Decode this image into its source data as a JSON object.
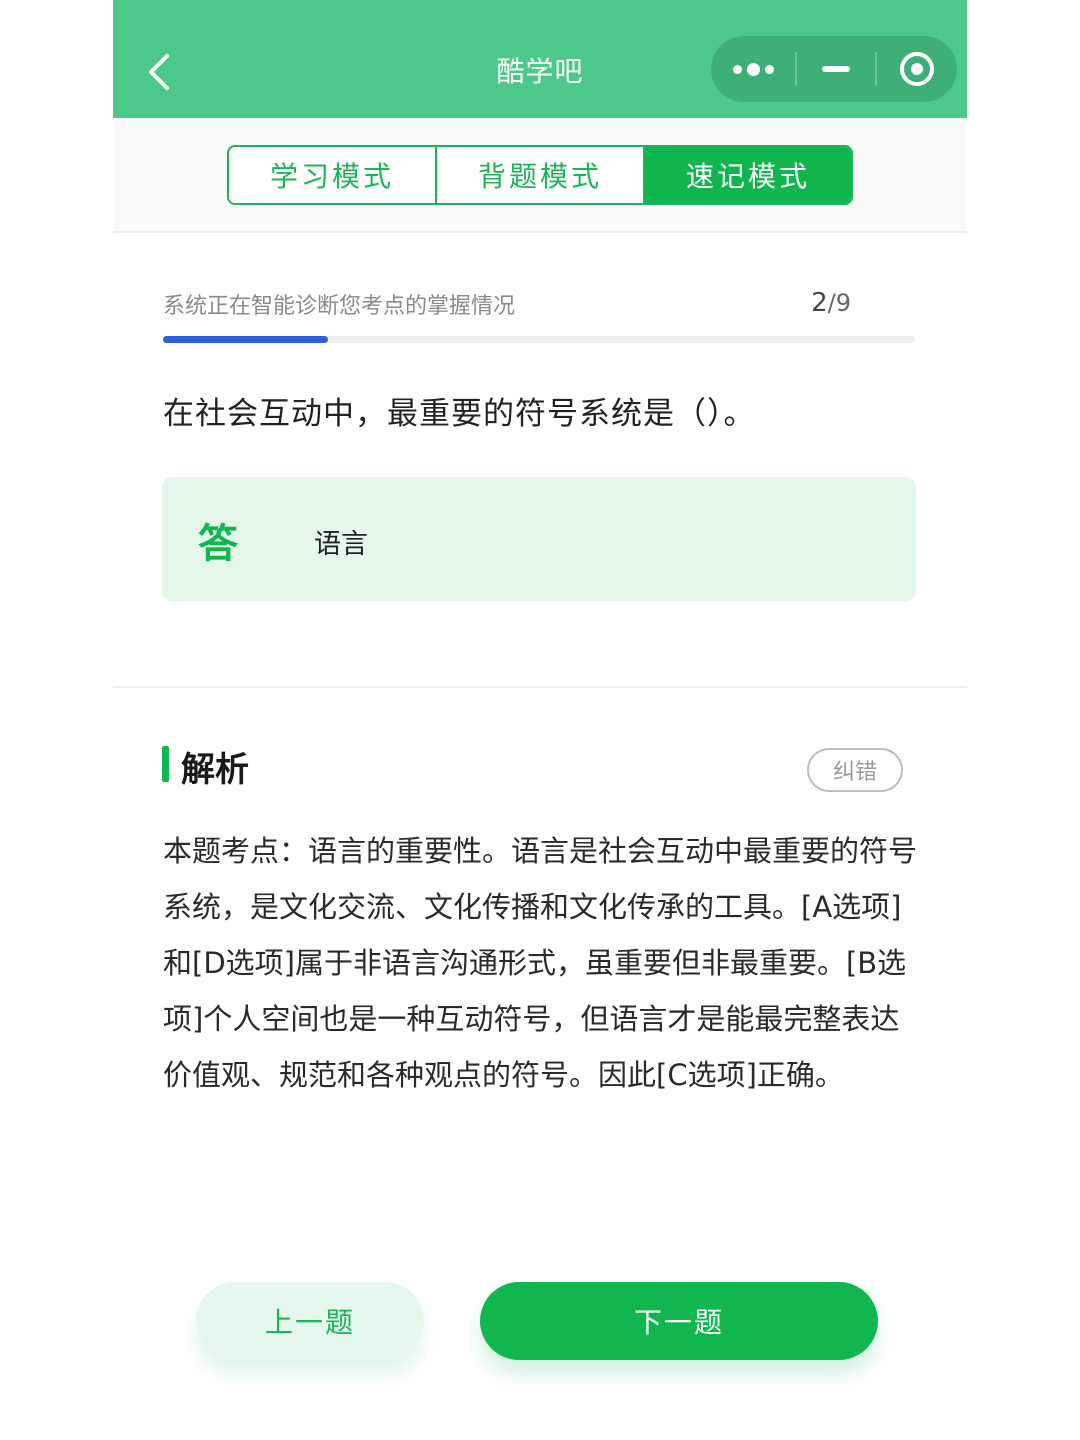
{
  "navbar": {
    "title": "酷学吧",
    "back_icon": "chevron-left-icon",
    "more_icon": "more-dots-icon",
    "minimize_icon": "minimize-icon",
    "close_icon": "record-circle-icon"
  },
  "mode_tabs": [
    {
      "label": "学习模式",
      "active": false
    },
    {
      "label": "背题模式",
      "active": false
    },
    {
      "label": "速记模式",
      "active": true
    }
  ],
  "progress": {
    "text": "系统正在智能诊断您考点的掌握情况",
    "current": "2",
    "total": "/9",
    "fraction": 0.22
  },
  "question": {
    "text": "在社会互动中，最重要的符号系统是（）。"
  },
  "answer": {
    "mark": "答",
    "text": "语言"
  },
  "analysis": {
    "title": "解析",
    "report_label": "纠错",
    "body": "本题考点：语言的重要性。语言是社会互动中最重要的符号系统，是文化交流、文化传播和文化传承的工具。[A选项]和[D选项]属于非语言沟通形式，虽重要但非最重要。[B选项]个人空间也是一种互动符号，但语言才是能最完整表达价值观、规范和各种观点的符号。因此[C选项]正确。"
  },
  "buttons": {
    "prev_label": "上一题",
    "next_label": "下一题"
  },
  "colors": {
    "navbar": "#4cc98a",
    "accent": "#10b64e",
    "progress": "#2f5fe0",
    "answer_bg": "#e5f7e8"
  }
}
